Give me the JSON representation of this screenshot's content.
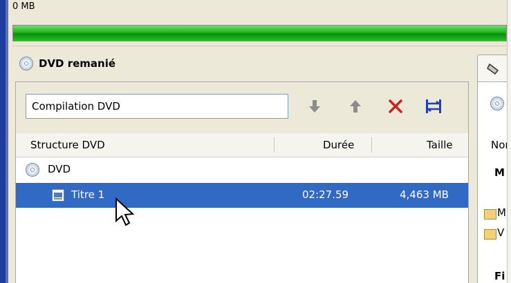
{
  "capacity": {
    "label": "0 MB",
    "fill_percent": 100,
    "color": "#22b022"
  },
  "panel": {
    "title": "DVD remanié"
  },
  "toolbar": {
    "compilation_value": "Compilation DVD",
    "icons": [
      "arrow-down-icon",
      "arrow-up-icon",
      "delete-icon",
      "fit-width-icon"
    ]
  },
  "columns": {
    "structure": "Structure DVD",
    "duree": "Durée",
    "taille": "Taille"
  },
  "tree": {
    "root": {
      "label": "DVD"
    },
    "items": [
      {
        "label": "Titre 1",
        "duree": "02:27.59",
        "taille": "4,463 MB",
        "selected": true
      }
    ]
  },
  "right_panel": {
    "header_text": "Nor",
    "row_text": "M",
    "items": [
      "M",
      "V"
    ],
    "bottom_text": "Fi"
  },
  "colors": {
    "selection": "#316ac5",
    "delete": "#d0201c",
    "fit": "#1f3fc0",
    "window": "#ece9d8"
  }
}
